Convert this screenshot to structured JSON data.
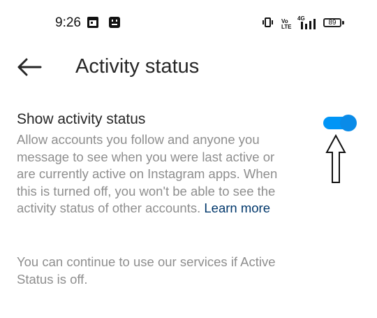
{
  "status_bar": {
    "time": "9:26",
    "network_top": "Vo",
    "network_bottom": "LTE",
    "network_type": "4G",
    "battery": "89"
  },
  "header": {
    "title": "Activity status"
  },
  "setting": {
    "title": "Show activity status",
    "description": "Allow accounts you follow and anyone you message to see when you were last active or are currently active on Instagram apps. When this is turned off, you won't be able to see the activity status of other accounts.",
    "link": "Learn more",
    "enabled": true
  },
  "footer_note": "You can continue to use our services if Active Status is off.",
  "colors": {
    "accent": "#0095f6",
    "secondary_text": "#8e8e8e",
    "link": "#00376b"
  }
}
